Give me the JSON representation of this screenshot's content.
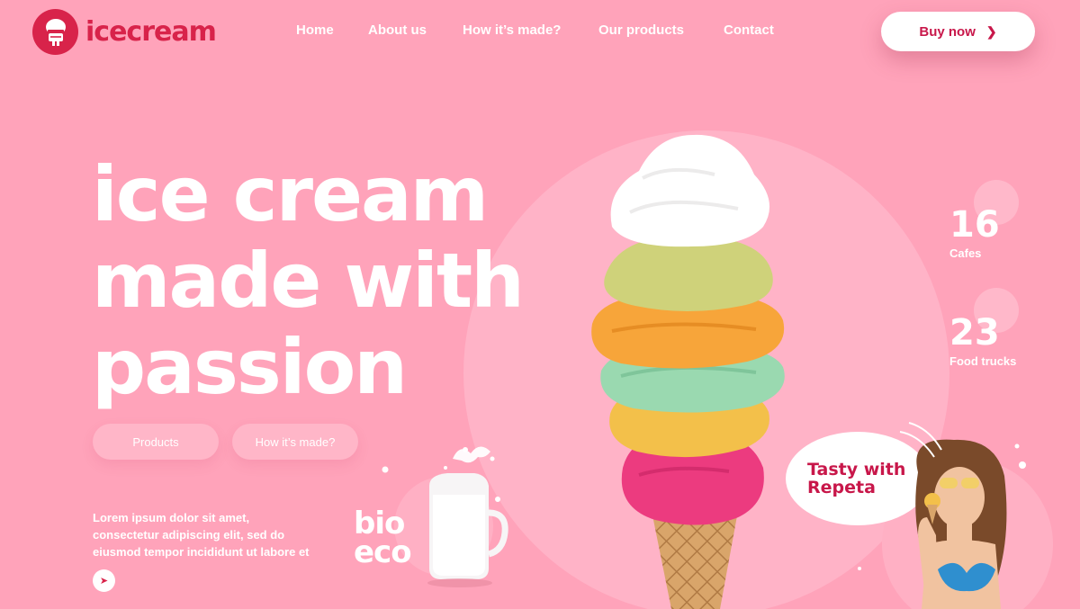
{
  "brand": {
    "name": "icecream",
    "color": "#d8234a"
  },
  "nav": {
    "items": [
      "Home",
      "About us",
      "How it’s made?",
      "Our products",
      "Contact"
    ]
  },
  "header": {
    "buy_label": "Buy now",
    "buy_icon": "chevron-right-icon"
  },
  "hero": {
    "title_lines": [
      "ice cream",
      "made with",
      "passion"
    ],
    "buttons": [
      "Products",
      "How it’s made?"
    ],
    "description_lines": [
      "Lorem ipsum dolor sit amet,",
      "consectetur adipiscing elit, sed do",
      "eiusmod tempor incididunt ut labore et"
    ],
    "arrow_icon": "arrow-right-icon"
  },
  "badge": {
    "lines": [
      "bio",
      "eco"
    ]
  },
  "stats": [
    {
      "value": "16",
      "label": "Cafes"
    },
    {
      "value": "23",
      "label": "Food trucks"
    }
  ],
  "bubble": {
    "lines": [
      "Tasty with",
      "Repeta"
    ]
  },
  "colors": {
    "background": "#ffa3ba",
    "accent": "#c8174a",
    "text": "#ffffff"
  }
}
